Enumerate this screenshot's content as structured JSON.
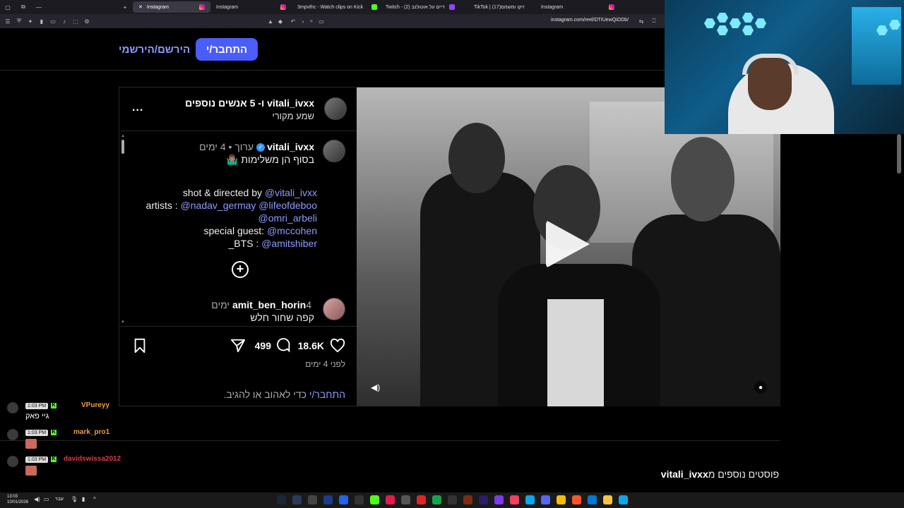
{
  "browser": {
    "tabs": [
      {
        "label": "Instagram",
        "active": true,
        "favicon": "instagram-icon"
      },
      {
        "label": "Instagram",
        "active": false,
        "favicon": "instagram-icon"
      },
      {
        "label": "3mpvthc - Watch clips on Kick",
        "active": false,
        "favicon": "kick-icon"
      },
      {
        "label": "Twitch - (2) דיים על אוטולנב",
        "active": false,
        "favicon": "twitch-icon"
      },
      {
        "label": "TikTok | זיקו ומשמם(17)",
        "active": false,
        "favicon": "tiktok-icon"
      },
      {
        "label": "Instagram",
        "active": false,
        "favicon": "instagram-icon"
      }
    ],
    "url": "instagram.com/reel/DTIUewQiODb/"
  },
  "nav": {
    "login_label": "התחבר/י",
    "signup_label": "הירשם/הירשמי"
  },
  "post": {
    "header_title": "vitali_ivxx ו- 5 אנשים נוספים",
    "header_subtitle": "שמע מקורי",
    "more_label": "...",
    "author": "vitali_ivxx",
    "author_meta": "ערוך • 4 ימים",
    "caption_first": "בסוף הן משלימות 🤷🏽‍♂️",
    "caption_lines": {
      "shot_prefix": "shot & directed by ",
      "shot_mention": "@vitali_ivxx",
      "artists_prefix": "artists : ",
      "artists_mention1": "@nadav_germay",
      "artists_mention2": "@lifeofdeboo",
      "artists_mention3": "@omri_arbeli",
      "guest_prefix": "special guest: ",
      "guest_mention": "@mccohen",
      "bts_prefix": "_BTS : ",
      "bts_mention": "@amitshiber"
    },
    "comment_user": "amit_ben_horin",
    "comment_time": "4 ימים",
    "comment_text": "קפה שחור חלש",
    "likes": "18.6K",
    "comments_count": "499",
    "posted_ago": "לפני 4 ימים",
    "login_prompt_link": "התחבר/י",
    "login_prompt_text": " כדי לאהוב או להגיב."
  },
  "more_posts": {
    "prefix": "פוסטים נוספים מ",
    "user": "vitali_ivxx"
  },
  "chat": [
    {
      "time": "1:03 PM",
      "name": "VPureyy",
      "name_color": "#e8a23a",
      "message": "גיי פאק",
      "emote": false
    },
    {
      "time": "1:03 PM",
      "name": "mark_pro1",
      "name_color": "#e8a23a",
      "message": "",
      "emote": true
    },
    {
      "time": "1:03 PM",
      "name": "davidswissa2012",
      "name_color": "#d93a4a",
      "message": "",
      "emote": true
    }
  ],
  "taskbar": {
    "time": "13:03",
    "date": "10/01/2026",
    "lang": "עבר"
  },
  "colors": {
    "accent": "#4a5df9",
    "link": "#8e9bff",
    "kick": "#53fc18"
  }
}
